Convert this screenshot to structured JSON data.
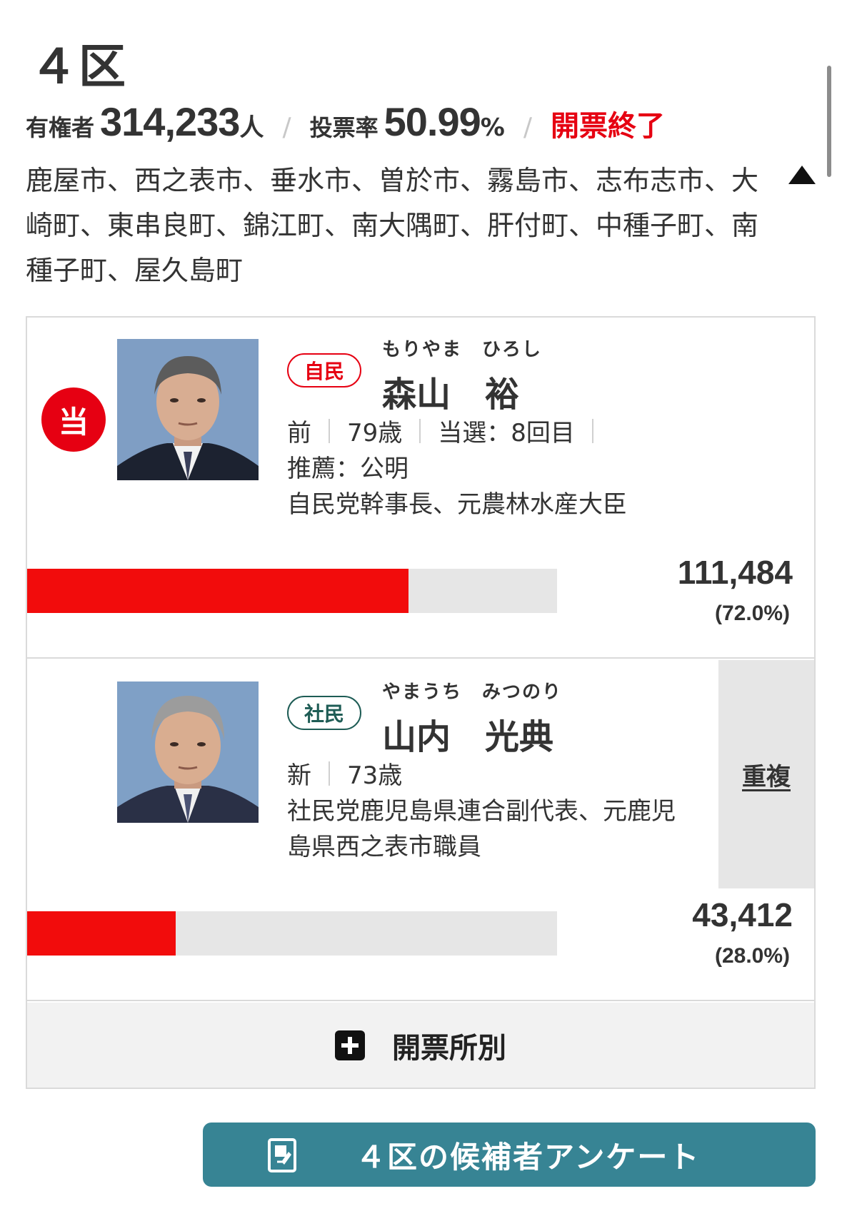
{
  "district": {
    "title": "４区"
  },
  "stats": {
    "voters_label": "有権者",
    "voters_value": "314,233",
    "voters_unit": "人",
    "sep": "/",
    "turnout_label": "投票率",
    "turnout_value": "50.99",
    "turnout_unit": "%",
    "status": "開票終了"
  },
  "area": {
    "text": "鹿屋市、西之表市、垂水市、曽於市、霧島市、志布志市、大崎町、東串良町、錦江町、南大隅町、肝付町、中種子町、南種子町、屋久島町",
    "toggle_icon": "triangle-up-icon"
  },
  "candidates": [
    {
      "win_badge": "当",
      "party": "自民",
      "furigana": "もりやま　ひろし",
      "name": "森山　裕",
      "status": "前",
      "age": "79歳",
      "elected": "当選：8回目",
      "recommend": "推薦：公明",
      "career": "自民党幹事長、元農林水産大臣",
      "votes": "111,484",
      "percent_label": "(72.0%)",
      "vote_share": 0.72
    },
    {
      "party": "社民",
      "furigana": "やまうち　みつのり",
      "name": "山内　光典",
      "status": "新",
      "age": "73歳",
      "career_line1": "社民党鹿児島県連合副代表、元鹿児",
      "career_line2": "島県西之表市職員",
      "duplicate": "重複",
      "votes": "43,412",
      "percent_label": "(28.0%)",
      "vote_share": 0.28
    }
  ],
  "precinct": {
    "label": "開票所別",
    "icon": "plus-square-icon"
  },
  "survey": {
    "label": "４区の候補者アンケート",
    "icon": "survey-doc-icon"
  },
  "colors": {
    "accent_red": "#e60012",
    "bar_red": "#f20c0c",
    "ldp": "#e60012",
    "sdp": "#1e5c55",
    "button_teal": "#378494"
  }
}
